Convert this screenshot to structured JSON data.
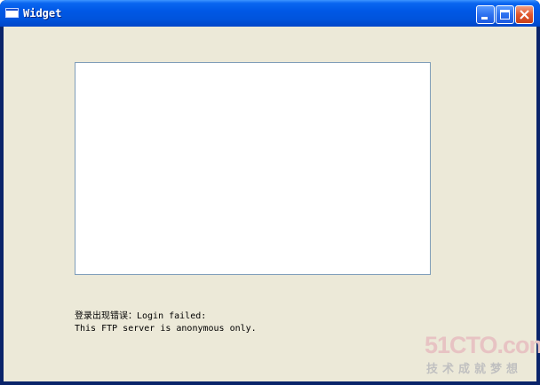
{
  "window": {
    "title": "Widget",
    "buttons": {
      "minimize": "minimize",
      "maximize": "maximize",
      "close": "close"
    }
  },
  "content": {
    "text_area_value": "",
    "status_line1": "登录出现错误：Login failed:",
    "status_line2": "This FTP server is anonymous only."
  },
  "watermark": {
    "logo": "51CTO.com",
    "tagline": "技术成就梦想"
  },
  "colors": {
    "titlebar": "#0054e3",
    "client_background": "#ece9d8",
    "text_area_border": "#7f9db9",
    "close_button": "#e0572c",
    "watermark": "#e7c3c3"
  }
}
